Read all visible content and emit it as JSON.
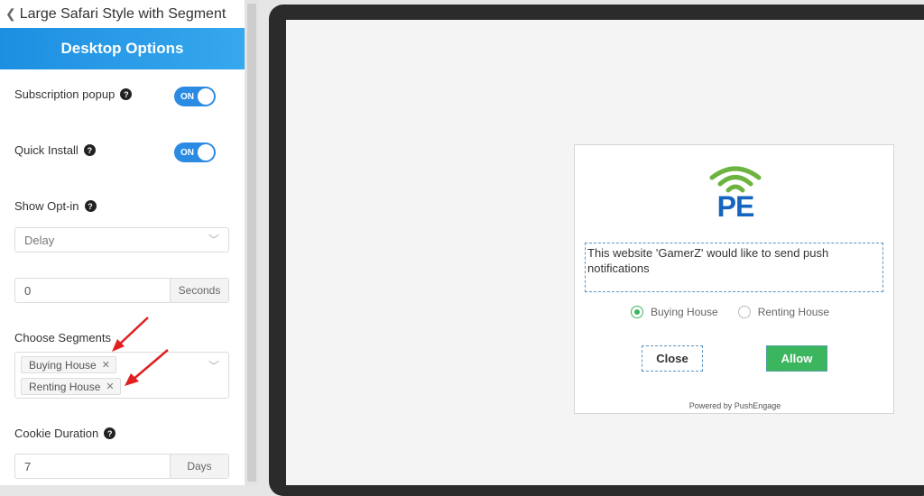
{
  "sidebar": {
    "back_title": "Large Safari Style with Segment",
    "tab": "Desktop Options",
    "subscription_popup": {
      "label": "Subscription popup",
      "toggle": "ON"
    },
    "quick_install": {
      "label": "Quick Install",
      "toggle": "ON"
    },
    "show_optin": {
      "label": "Show Opt-in",
      "value": "Delay"
    },
    "delay": {
      "value": "0",
      "unit": "Seconds"
    },
    "choose_segments": {
      "label": "Choose Segments",
      "tags": [
        "Buying House",
        "Renting House"
      ]
    },
    "cookie_duration": {
      "label": "Cookie Duration",
      "value": "7",
      "unit": "Days"
    },
    "help_glyph": "?"
  },
  "popup": {
    "logo_text": "PE",
    "message": "This website 'GamerZ' would like to send push notifications",
    "options": [
      "Buying House",
      "Renting House"
    ],
    "selected_option": "Buying House",
    "close_label": "Close",
    "allow_label": "Allow",
    "powered_by": "Powered by PushEngage"
  },
  "colors": {
    "accent_blue": "#2b8be3",
    "allow_green": "#3bb55e",
    "logo_blue": "#1565c0",
    "logo_green": "#6cb33f",
    "arrow_red": "#e02020"
  }
}
